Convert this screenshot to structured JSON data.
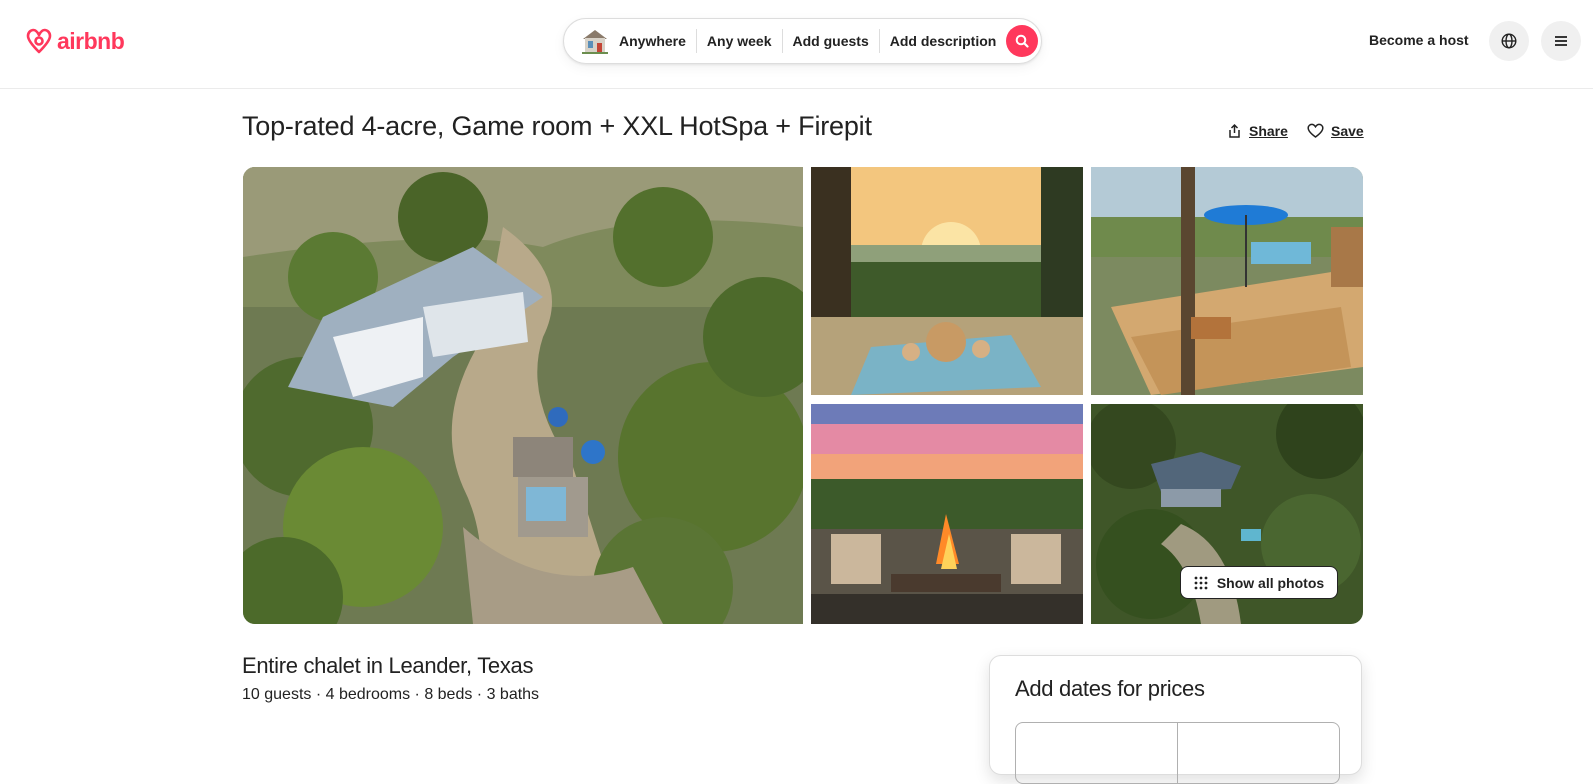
{
  "header": {
    "logo_text": "airbnb",
    "search": {
      "location": "Anywhere",
      "dates": "Any week",
      "guests": "Add guests",
      "description": "Add description"
    },
    "become_host": "Become a host"
  },
  "listing": {
    "title": "Top-rated 4-acre, Game room + XXL HotSpa + Firepit",
    "share_label": "Share",
    "save_label": "Save",
    "show_all_photos": "Show all photos",
    "property_title": "Entire chalet in Leander, Texas",
    "details": "10 guests · 4 bedrooms · 8 beds · 3 baths"
  },
  "booking": {
    "title": "Add dates for prices"
  },
  "icons": {
    "logo": "airbnb-logo-icon",
    "house": "house-icon",
    "search": "search-icon",
    "globe": "globe-icon",
    "menu": "menu-icon",
    "share": "share-icon",
    "save": "heart-icon",
    "grid": "grid-dots-icon"
  },
  "colors": {
    "brand": "#ff385c",
    "text": "#222222",
    "border": "#dddddd"
  }
}
